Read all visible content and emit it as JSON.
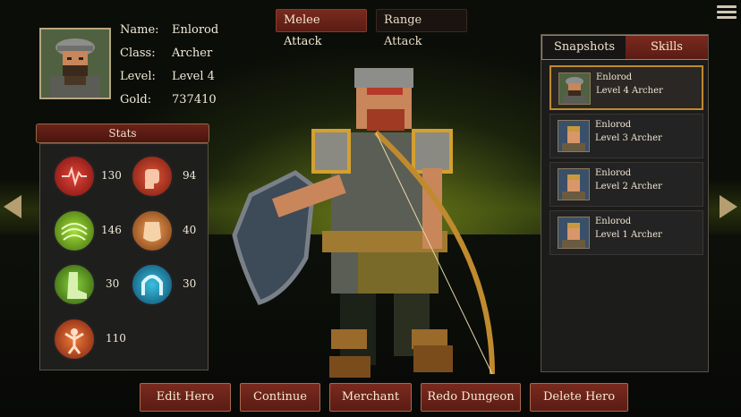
{
  "top_tabs": {
    "melee": "Melee Attack",
    "range": "Range Attack",
    "active": "melee"
  },
  "menu": {
    "icon": "hamburger-menu-icon"
  },
  "hero_info": {
    "name_label": "Name:",
    "name": "Enlorod",
    "class_label": "Class:",
    "class": "Archer",
    "level_label": "Level:",
    "level": "Level 4",
    "gold_label": "Gold:",
    "gold": "737410"
  },
  "stats": {
    "title": "Stats",
    "items": [
      {
        "icon": "heartbeat-icon",
        "value": "130",
        "color": "#b8231d"
      },
      {
        "icon": "fist-icon",
        "value": "94",
        "color": "#b0301e"
      },
      {
        "icon": "speed-swirl-icon",
        "value": "146",
        "color": "#6aa81c"
      },
      {
        "icon": "armor-icon",
        "value": "40",
        "color": "#c0682a"
      },
      {
        "icon": "boot-icon",
        "value": "30",
        "color": "#5e9a20"
      },
      {
        "icon": "horseshoe-icon",
        "value": "30",
        "color": "#1c8aa8"
      },
      {
        "icon": "burst-figure-icon",
        "value": "110",
        "color": "#c04a1e"
      }
    ]
  },
  "right_tabs": {
    "snapshots": "Snapshots",
    "skills": "Skills",
    "active": "skills"
  },
  "snapshots": [
    {
      "name": "Enlorod",
      "level": "Level 4 Archer",
      "selected": true
    },
    {
      "name": "Enlorod",
      "level": "Level 3 Archer",
      "selected": false
    },
    {
      "name": "Enlorod",
      "level": "Level 2 Archer",
      "selected": false
    },
    {
      "name": "Enlorod",
      "level": "Level 1 Archer",
      "selected": false
    }
  ],
  "nav": {
    "prev_icon": "left-arrow-icon",
    "next_icon": "right-arrow-icon"
  },
  "buttons": {
    "edit": "Edit Hero",
    "continue": "Continue",
    "merchant": "Merchant",
    "redo": "Redo Dungeon",
    "delete": "Delete Hero"
  }
}
